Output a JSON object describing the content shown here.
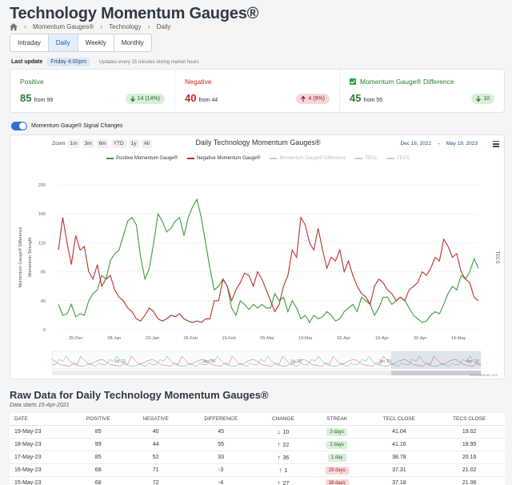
{
  "page": {
    "title": "Technology Momentum Gauges®",
    "breadcrumb": [
      "Momentum Gauges®",
      "Technology",
      "Daily"
    ]
  },
  "tabs": [
    "Intraday",
    "Daily",
    "Weekly",
    "Monthly"
  ],
  "last_update": {
    "label": "Last update",
    "value": "Friday 4:00pm",
    "note": "Updates every 15 minutes during market hours"
  },
  "cards": {
    "positive": {
      "label": "Positive",
      "value": "85",
      "from": "from 99",
      "change": "14 (14%)"
    },
    "negative": {
      "label": "Negative",
      "value": "40",
      "from": "from 44",
      "change": "4 (9%)"
    },
    "difference": {
      "label": "Momentum Gauge® Difference",
      "value": "45",
      "from": "from 55",
      "change": "10"
    }
  },
  "toggle": {
    "label": "Momentum Gauge® Signal Changes",
    "on": true
  },
  "chart_header": {
    "zoom_label": "Zoom",
    "zoom_buttons": [
      "1m",
      "3m",
      "6m",
      "YTD",
      "1y",
      "All"
    ],
    "date_from": "Dec 16, 2022",
    "date_arrow": "→",
    "date_to": "May 19, 2023",
    "credit": "vmbreakouts.com"
  },
  "colors": {
    "positive": "#3a9d3a",
    "negative": "#b8322a",
    "accent": "#2f6fd6"
  },
  "chart_data": {
    "type": "line",
    "title": "Daily Technology Momentum Gauges®",
    "ylabel": "Momentum Gauge® Difference",
    "ylabel2": "Momentum Strength",
    "ylabel_right": "TECS",
    "ylim": [
      0,
      200
    ],
    "yticks": [
      0,
      40,
      80,
      120,
      160,
      200
    ],
    "xticks": [
      "25-Dec",
      "08-Jan",
      "22-Jan",
      "05-Feb",
      "19-Feb",
      "05-Mar",
      "19-Mar",
      "02-Apr",
      "16-Apr",
      "30-Apr",
      "14-May"
    ],
    "navigator_labels": [
      "Jul '21",
      "Jan '22",
      "Jul '22",
      "Jan '23",
      "Apr '23"
    ],
    "legend": [
      "Positive Momentum Gauge®",
      "Negative Momentum Gauge®",
      "Momentum Gauge® Difference",
      "TECL",
      "TECS"
    ],
    "series": [
      {
        "name": "Positive Momentum Gauge®",
        "values": [
          35,
          20,
          22,
          35,
          18,
          22,
          20,
          40,
          50,
          55,
          75,
          70,
          95,
          105,
          110,
          130,
          150,
          155,
          145,
          100,
          70,
          85,
          120,
          160,
          150,
          135,
          140,
          150,
          155,
          130,
          155,
          170,
          180,
          155,
          120,
          85,
          55,
          60,
          70,
          60,
          30,
          20,
          40,
          35,
          28,
          35,
          30,
          35,
          30,
          30,
          50,
          40,
          45,
          25,
          40,
          30,
          15,
          20,
          10,
          20,
          15,
          18,
          25,
          20,
          12,
          15,
          25,
          30,
          35,
          25,
          45,
          40,
          35,
          20,
          30,
          45,
          45,
          35,
          40,
          45,
          40,
          30,
          20,
          15,
          10,
          12,
          20,
          25,
          22,
          35,
          50,
          60,
          55,
          75,
          70,
          80,
          98,
          85
        ]
      },
      {
        "name": "Negative Momentum Gauge®",
        "values": [
          110,
          155,
          120,
          90,
          130,
          110,
          115,
          80,
          70,
          90,
          60,
          70,
          75,
          55,
          45,
          40,
          30,
          25,
          15,
          12,
          20,
          30,
          25,
          15,
          12,
          15,
          20,
          18,
          22,
          15,
          12,
          10,
          12,
          10,
          15,
          15,
          40,
          40,
          70,
          60,
          40,
          55,
          65,
          78,
          75,
          60,
          80,
          70,
          55,
          40,
          25,
          35,
          60,
          75,
          110,
          100,
          155,
          145,
          120,
          110,
          140,
          110,
          85,
          100,
          95,
          110,
          80,
          95,
          75,
          60,
          50,
          45,
          35,
          60,
          70,
          65,
          55,
          50,
          40,
          45,
          40,
          55,
          60,
          65,
          80,
          75,
          85,
          100,
          95,
          125,
          115,
          100,
          105,
          80,
          70,
          65,
          45,
          40
        ]
      }
    ]
  },
  "raw": {
    "title": "Raw Data for Daily Technology Momentum Gauges®",
    "subtitle": "Data starts 15-Apr-2021",
    "headers": [
      "DATE",
      "POSITIVE",
      "NEGATIVE",
      "DIFFERENCE",
      "CHANGE",
      "STREAK",
      "TECL CLOSE",
      "TECS CLOSE"
    ],
    "rows": [
      {
        "date": "19-May-23",
        "pos": "85",
        "neg": "40",
        "diff": "45",
        "dir": "down",
        "change": "10",
        "streak": "3 days",
        "streak_color": "green",
        "tecl": "41.04",
        "tecs": "19.02"
      },
      {
        "date": "18-May-23",
        "pos": "99",
        "neg": "44",
        "diff": "55",
        "dir": "up",
        "change": "22",
        "streak": "2 days",
        "streak_color": "green",
        "tecl": "41.16",
        "tecs": "18.95"
      },
      {
        "date": "17-May-23",
        "pos": "85",
        "neg": "52",
        "diff": "33",
        "dir": "up",
        "change": "36",
        "streak": "1 day",
        "streak_color": "green",
        "tecl": "38.78",
        "tecs": "20.16"
      },
      {
        "date": "16-May-23",
        "pos": "68",
        "neg": "71",
        "diff": "-3",
        "dir": "up",
        "change": "1",
        "streak": "29 days",
        "streak_color": "red",
        "tecl": "37.31",
        "tecs": "21.02"
      },
      {
        "date": "15-May-23",
        "pos": "68",
        "neg": "72",
        "diff": "-4",
        "dir": "up",
        "change": "27",
        "streak": "28 days",
        "streak_color": "red",
        "tecl": "37.18",
        "tecs": "21.06"
      }
    ]
  }
}
